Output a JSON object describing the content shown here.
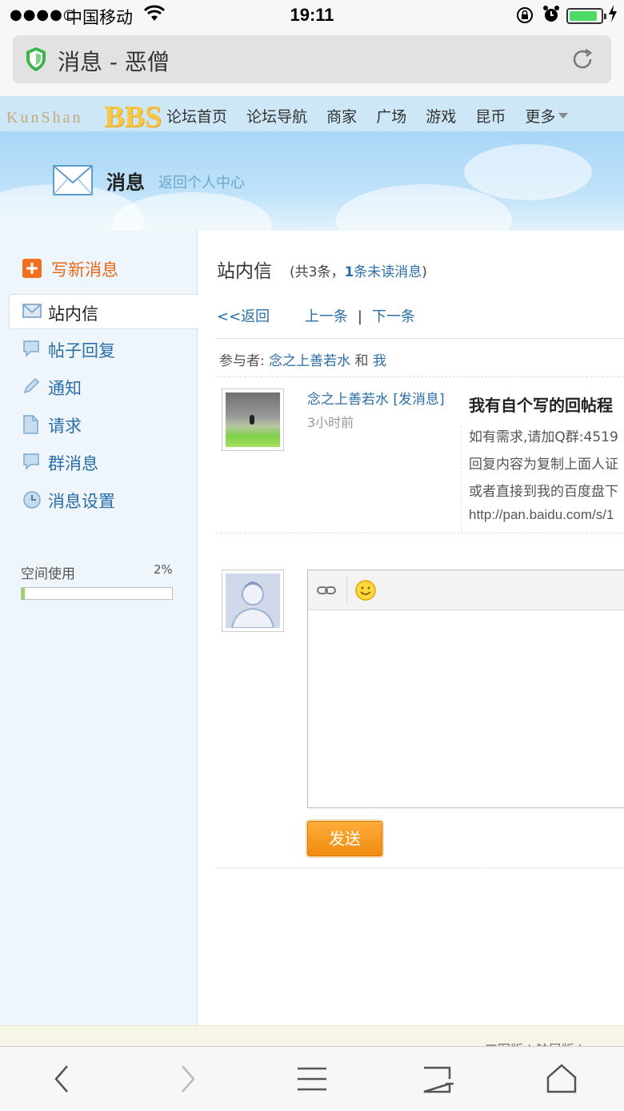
{
  "status_bar": {
    "signal": "●●●●○",
    "carrier": "中国移动",
    "time": "19:11"
  },
  "browser": {
    "page_title": "消息 - 恶僧"
  },
  "site": {
    "logo_text": "KunShan",
    "logo_bbs": "BBS",
    "nav": [
      "论坛首页",
      "论坛导航",
      "商家",
      "广场",
      "游戏",
      "昆币",
      "更多"
    ],
    "header_title": "消息",
    "header_link": "返回个人中心"
  },
  "sidebar": {
    "new_message": "写新消息",
    "items": [
      {
        "label": "站内信",
        "icon": "envelope-icon"
      },
      {
        "label": "帖子回复",
        "icon": "comment-icon"
      },
      {
        "label": "通知",
        "icon": "pencil-icon"
      },
      {
        "label": "请求",
        "icon": "document-icon"
      },
      {
        "label": "群消息",
        "icon": "chat-bubble-icon"
      },
      {
        "label": "消息设置",
        "icon": "clock-icon"
      }
    ],
    "space_label": "空间使用",
    "space_pct": "2%",
    "space_fraction": 0.02
  },
  "main": {
    "title": "站内信",
    "count_prefix": "(共3条，",
    "unread_num": "1",
    "unread_text": "条未读消息",
    "count_suffix": ")",
    "back": "<<返回",
    "prev": "上一条",
    "separator": "|",
    "next": "下一条",
    "participants_label": "参与者:",
    "participant1": "念之上善若水",
    "participants_and": "和",
    "participant2": "我",
    "message": {
      "sender": "念之上善若水",
      "send_link": "[发消息]",
      "time": "3小时前",
      "subject": "我有自个写的回帖程",
      "lines": [
        "如有需求,请加Q群:4519",
        "回复内容为复制上面人证",
        "或者直接到我的百度盘下",
        "http://pan.baidu.com/s/1"
      ]
    },
    "send_button": "发送"
  },
  "footer": {
    "versions": "工图版  |  触屏版  |"
  },
  "colors": {
    "link": "#2b6ea8",
    "accent_orange": "#f18a0f",
    "sidebar_bg": "#eef5fb"
  }
}
